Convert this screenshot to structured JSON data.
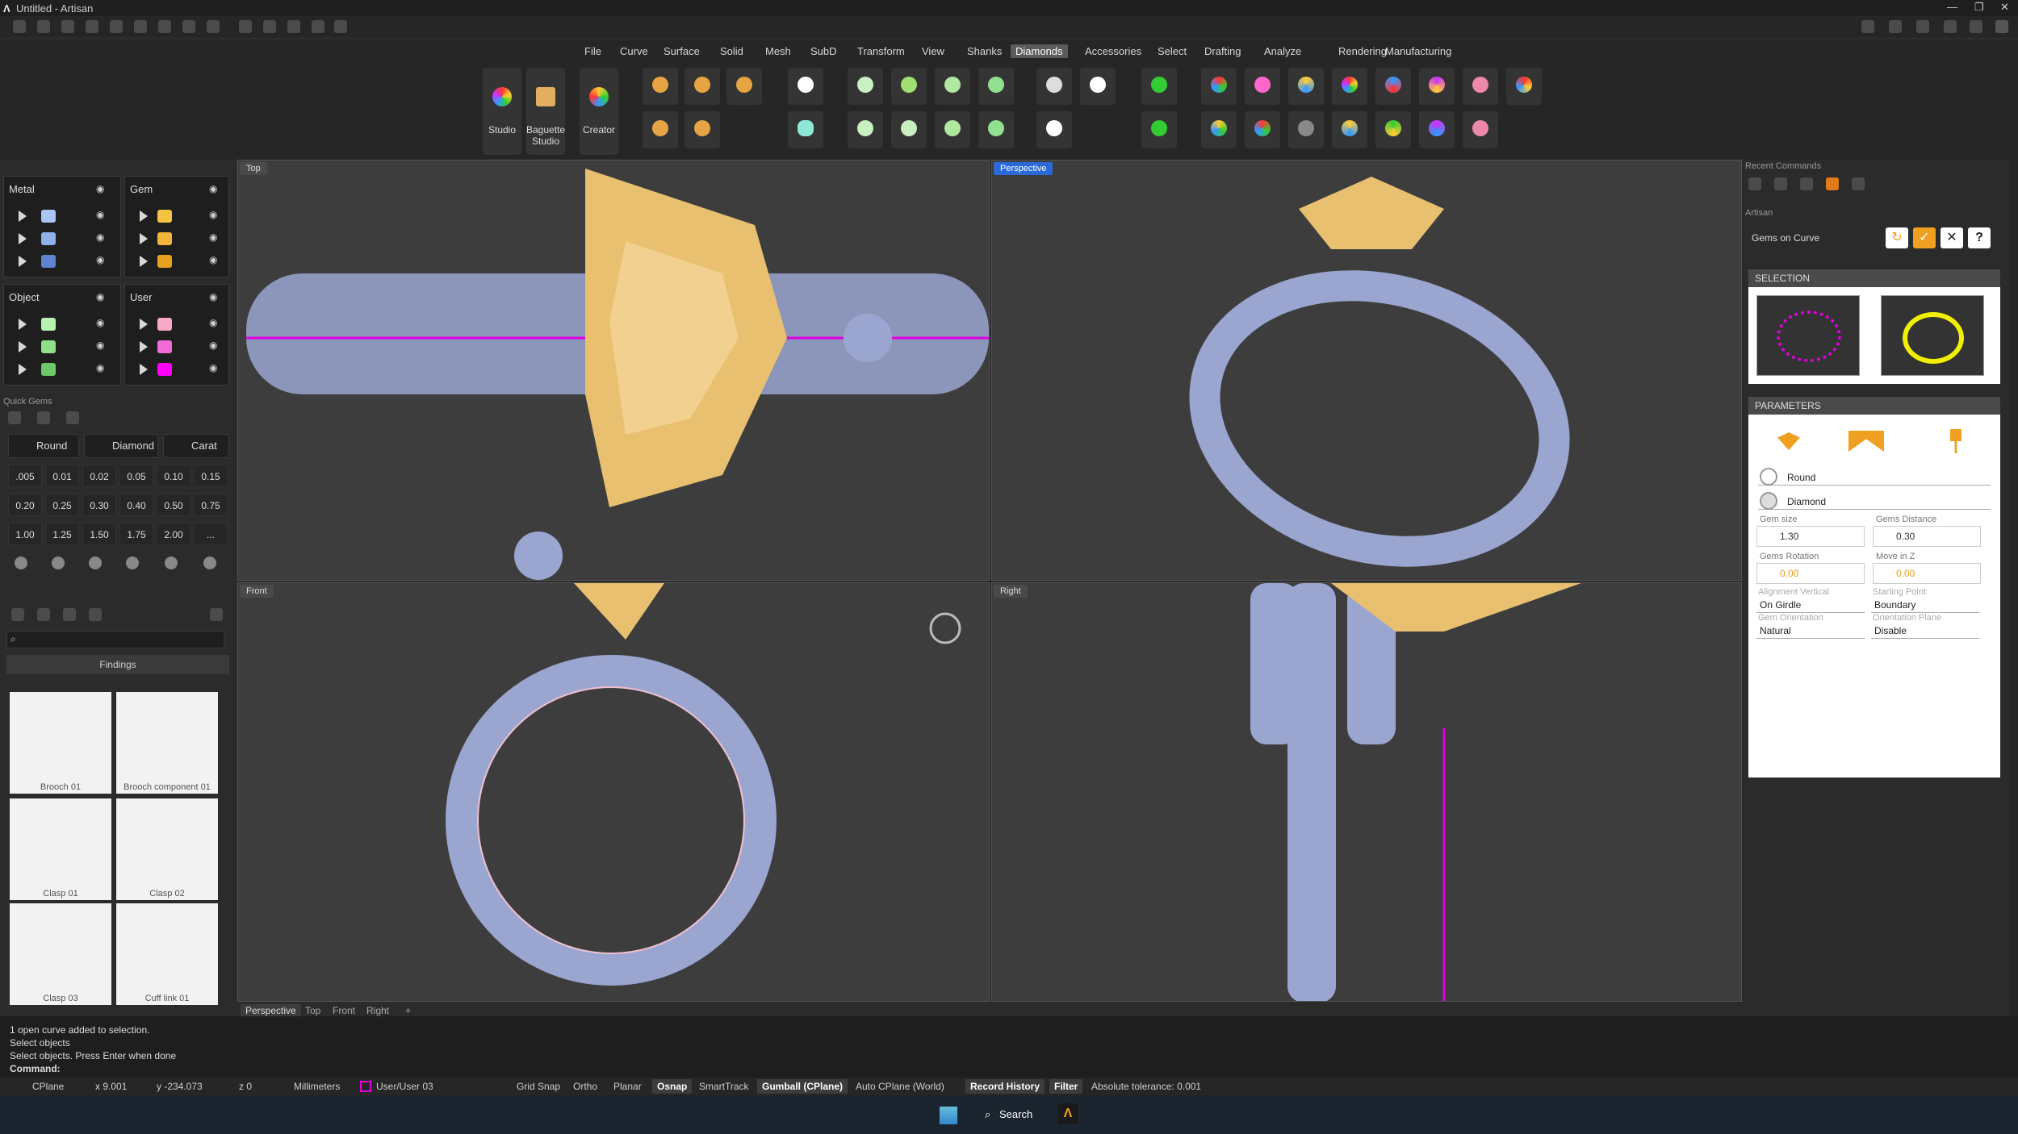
{
  "window": {
    "title": "Untitled - Artisan"
  },
  "menu": [
    "File",
    "Curve",
    "Surface",
    "Solid",
    "Mesh",
    "SubD",
    "Transform",
    "View",
    "Shanks",
    "Diamonds",
    "Accessories",
    "Select",
    "Drafting",
    "Analyze",
    "Rendering",
    "Manufacturing"
  ],
  "menu_active": "Diamonds",
  "ribbon": {
    "studio": "Studio",
    "baguette_l1": "Baguette",
    "baguette_l2": "Studio",
    "creator": "Creator"
  },
  "layers": {
    "metal": "Metal",
    "gem": "Gem",
    "object": "Object",
    "user": "User",
    "metal_colors": [
      "#a9c4f5",
      "#8fb0ea",
      "#5f83d0"
    ],
    "gem_colors": [
      "#f5c242",
      "#f2b43a",
      "#e8a020"
    ],
    "object_colors": [
      "#b8f2b0",
      "#8fe088",
      "#6cc86b"
    ],
    "user_colors": [
      "#f6a8c8",
      "#f06ad8",
      "#ff00ff"
    ]
  },
  "quick_gems": {
    "title": "Quick Gems",
    "shape": "Round",
    "material": "Diamond",
    "unit": "Carat",
    "sizes": [
      ".005",
      "0.01",
      "0.02",
      "0.05",
      "0.10",
      "0.15",
      "0.20",
      "0.25",
      "0.30",
      "0.40",
      "0.50",
      "0.75",
      "1.00",
      "1.25",
      "1.50",
      "1.75",
      "2.00",
      "..."
    ]
  },
  "library": {
    "category": "Findings",
    "items": [
      "Brooch 01",
      "Brooch component 01",
      "Clasp 01",
      "Clasp 02",
      "Clasp 03",
      "Cuff link 01"
    ]
  },
  "viewports": {
    "top": "Top",
    "perspective": "Perspective",
    "front": "Front",
    "right": "Right"
  },
  "viewport_tabs": [
    "Perspective",
    "Top",
    "Front",
    "Right"
  ],
  "viewport_tabs_active": "Perspective",
  "right_panel": {
    "recent_commands": "Recent Commands",
    "artisan": "Artisan",
    "command": "Gems on Curve",
    "selection": "SELECTION",
    "parameters": "PARAMETERS",
    "shape": "Round",
    "material": "Diamond",
    "gem_size_label": "Gem size",
    "gem_size": "1.30",
    "gems_distance_label": "Gems Distance",
    "gems_distance": "0.30",
    "gems_rotation_label": "Gems Rotation",
    "gems_rotation": "0.00",
    "move_z_label": "Move in Z",
    "move_z": "0.00",
    "align_vertical_label": "Alignment Vertical",
    "align_vertical": "On Girdle",
    "starting_point_label": "Starting Point",
    "starting_point": "Boundary",
    "gem_orientation_label": "Gem Orientation",
    "gem_orientation": "Natural",
    "orientation_plane_label": "Orientation Plane",
    "orientation_plane": "Disable",
    "help": "?"
  },
  "command_history": [
    "1 open curve added to selection.",
    "Select objects",
    "Select objects. Press Enter when done"
  ],
  "command_prompt": "Command:",
  "status": {
    "cplane": "CPlane",
    "x": "x 9.001",
    "y": "y -234.073",
    "z": "z 0",
    "units": "Millimeters",
    "layer": "User/User 03",
    "grid_snap": "Grid Snap",
    "ortho": "Ortho",
    "planar": "Planar",
    "osnap": "Osnap",
    "smarttrack": "SmartTrack",
    "gumball": "Gumball (CPlane)",
    "auto_cplane": "Auto CPlane (World)",
    "record_history": "Record History",
    "filter": "Filter",
    "tolerance": "Absolute tolerance: 0.001"
  },
  "taskbar": {
    "search": "Search"
  }
}
